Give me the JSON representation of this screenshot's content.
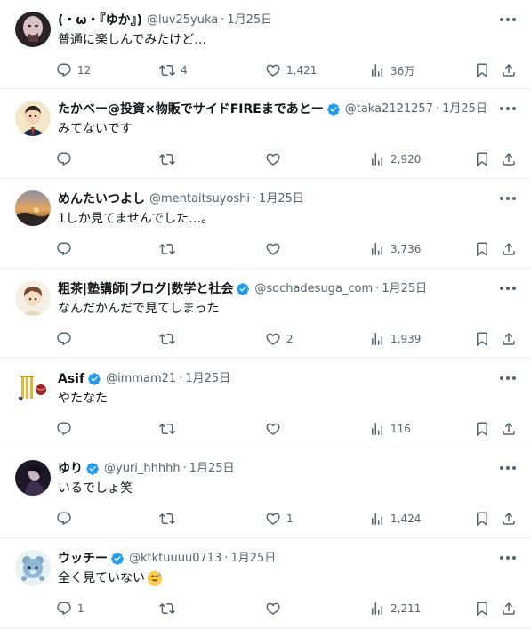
{
  "tweets": [
    {
      "name": "(・ω・『ゆか』)",
      "verified": false,
      "handle": "@luv25yuka",
      "sep": "·",
      "time": "1月25日",
      "text": "普通に楽しんでみたけど…",
      "emoji": "",
      "replies": "12",
      "retweets": "4",
      "likes": "1,421",
      "views": "36万",
      "avatar": "dark-face-photo"
    },
    {
      "name": "たかべー@投資×物販でサイドFIREまであとー",
      "verified": true,
      "handle": "@taka2121257",
      "sep": "·",
      "time": "1月25日",
      "text": "みてないです",
      "emoji": "",
      "replies": "",
      "retweets": "",
      "likes": "",
      "views": "2,920",
      "avatar": "cartoon-man-suit"
    },
    {
      "name": "めんたいつよし",
      "verified": false,
      "handle": "@mentaitsuyoshi",
      "sep": "·",
      "time": "1月25日",
      "text": "1しか見てませんでした…。",
      "emoji": "",
      "replies": "",
      "retweets": "",
      "likes": "",
      "views": "3,736",
      "avatar": "sunset-landscape"
    },
    {
      "name": "粗茶|塾講師|ブログ|数学と社会",
      "verified": true,
      "handle": "@sochadesuga_com",
      "sep": "·",
      "time": "1月25日",
      "text": "なんだかんだで見てしまった",
      "emoji": "",
      "replies": "",
      "retweets": "",
      "likes": "2",
      "views": "1,939",
      "avatar": "anime-boy-brown-hair"
    },
    {
      "name": "Asif",
      "verified": true,
      "handle": "@immam21",
      "sep": "·",
      "time": "1月25日",
      "text": "やたなた",
      "emoji": "",
      "replies": "",
      "retweets": "",
      "likes": "",
      "views": "116",
      "avatar": "cricket-stumps-ball"
    },
    {
      "name": "ゆり",
      "verified": true,
      "handle": "@yuri_hhhhh",
      "sep": "·",
      "time": "1月25日",
      "text": "いるでしょ笑",
      "emoji": "",
      "replies": "",
      "retweets": "",
      "likes": "1",
      "views": "1,424",
      "avatar": "dark-figure-photo"
    },
    {
      "name": "ウッチー",
      "verified": true,
      "handle": "@ktktuuuu0713",
      "sep": "·",
      "time": "1月25日",
      "text": "全く見ていない",
      "emoji": "sweat-smile-emoji",
      "replies": "1",
      "retweets": "",
      "likes": "",
      "views": "2,211",
      "avatar": "blue-bear-character"
    }
  ],
  "colors": {
    "verified": "#1d9bf0",
    "secondary_text": "#536471",
    "primary_text": "#0f1419",
    "divider": "#eff3f4"
  }
}
